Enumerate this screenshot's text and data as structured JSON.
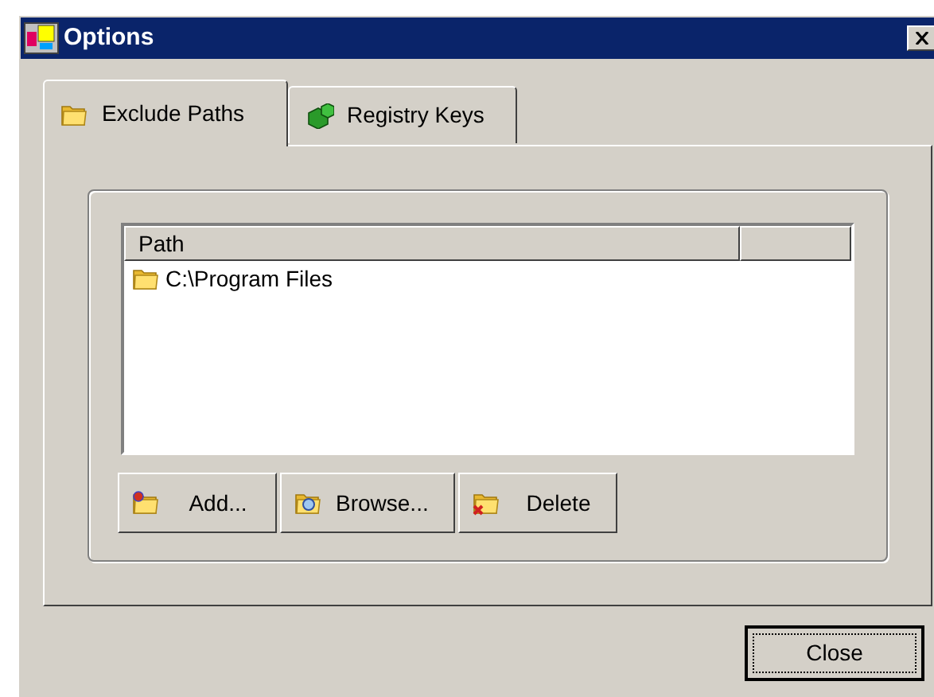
{
  "window": {
    "title": "Options"
  },
  "tabs": [
    {
      "label": "Exclude Paths",
      "selected": true,
      "kind": "folder"
    },
    {
      "label": "Registry Keys",
      "selected": false,
      "kind": "registry"
    }
  ],
  "list": {
    "columns": [
      "Path"
    ],
    "rows": [
      {
        "path": "C:\\Program Files",
        "selected": false
      }
    ]
  },
  "buttons": [
    {
      "label": "Add...",
      "kind": "add"
    },
    {
      "label": "Browse...",
      "kind": "browse"
    },
    {
      "label": "Delete",
      "kind": "delete"
    }
  ],
  "close_button": {
    "label": "Close"
  }
}
